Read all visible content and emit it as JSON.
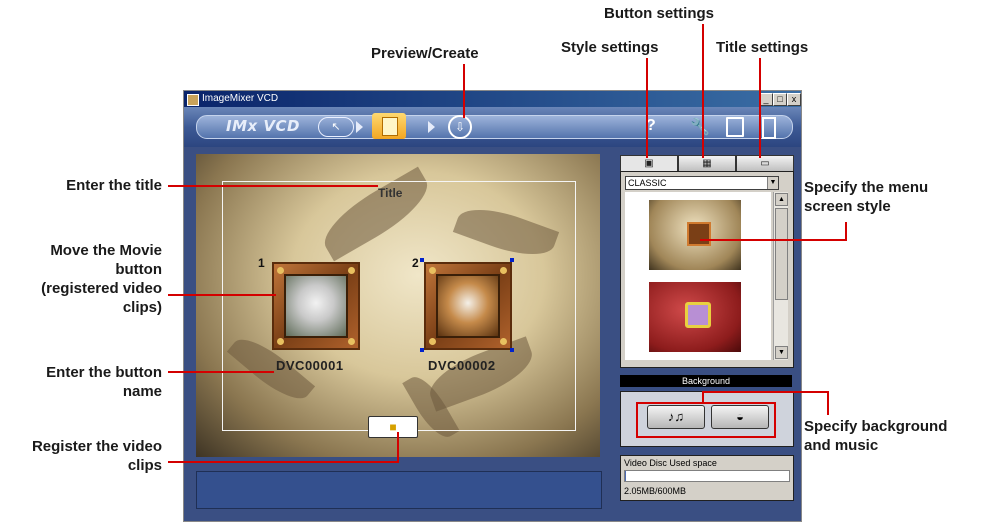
{
  "window": {
    "title": "ImageMixer VCD",
    "minimize": "_",
    "maximize": "□",
    "close": "x"
  },
  "toolbar": {
    "logo": "IMx VCD",
    "help": "?"
  },
  "canvas": {
    "menu_title": "Title",
    "buttons": [
      {
        "number": "1",
        "name": "DVC00001"
      },
      {
        "number": "2",
        "name": "DVC00002"
      }
    ]
  },
  "right_panel": {
    "style_select": "CLASSIC",
    "background_label": "Background",
    "music_button": "♪♫",
    "disc_label": "Video Disc    Used space",
    "disc_used": "2.05MB/600MB",
    "disc_used_fraction": 0.0034
  },
  "callouts": {
    "button_settings": "Button settings",
    "preview_create": "Preview/Create",
    "style_settings": "Style settings",
    "title_settings": "Title settings",
    "enter_title": "Enter the title",
    "move_movie": [
      "Move the Movie",
      "button",
      "(registered video",
      "clips)"
    ],
    "enter_button_name": [
      "Enter the button",
      "name"
    ],
    "register": [
      "Register the video",
      "clips"
    ],
    "menu_style": [
      "Specify the menu",
      "screen style"
    ],
    "bg_music": [
      "Specify background",
      "and music"
    ]
  },
  "colors": {
    "callout_line": "#d40000",
    "window_bg": "#3a4f83",
    "active_step": "#f2a623"
  }
}
